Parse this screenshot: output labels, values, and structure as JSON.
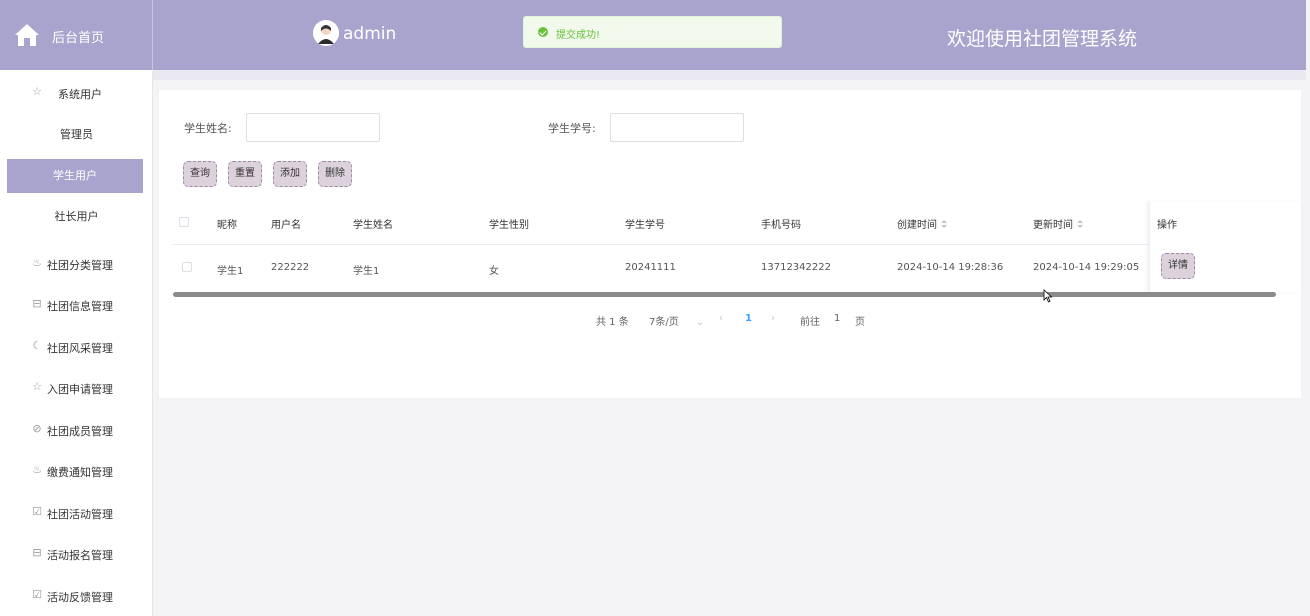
{
  "header": {
    "home_label": "后台首页",
    "user_name": "admin",
    "toast_text": "提交成功!",
    "site_title": "欢迎使用社团管理系统",
    "bg_color": "#a9a4cd"
  },
  "sidebar": {
    "group_system": {
      "icon": "star-icon",
      "label": "系统用户"
    },
    "sub_items": [
      {
        "label": "管理员",
        "active": false
      },
      {
        "label": "学生用户",
        "active": true
      },
      {
        "label": "社长用户",
        "active": false
      }
    ],
    "items": [
      {
        "icon": "flame-icon",
        "label": "社团分类管理"
      },
      {
        "icon": "basket-icon",
        "label": "社团信息管理"
      },
      {
        "icon": "moon-icon",
        "label": "社团风采管理"
      },
      {
        "icon": "star-icon",
        "label": "入团申请管理"
      },
      {
        "icon": "compass-icon",
        "label": "社团成员管理"
      },
      {
        "icon": "flame-icon",
        "label": "缴费通知管理"
      },
      {
        "icon": "calendar-check-icon",
        "label": "社团活动管理"
      },
      {
        "icon": "basket-icon",
        "label": "活动报名管理"
      },
      {
        "icon": "calendar-check-icon",
        "label": "活动反馈管理"
      }
    ]
  },
  "search": {
    "name_label": "学生姓名:",
    "name_value": "",
    "id_label": "学生学号:",
    "id_value": ""
  },
  "buttons": {
    "query": "查询",
    "reset": "重置",
    "add": "添加",
    "delete": "删除"
  },
  "table": {
    "headers": {
      "nickname": "昵称",
      "username": "用户名",
      "student_name": "学生姓名",
      "gender": "学生性别",
      "student_id": "学生学号",
      "phone": "手机号码",
      "created": "创建时间",
      "updated": "更新时间",
      "actions": "操作"
    },
    "rows": [
      {
        "nickname": "学生1",
        "username": "222222",
        "student_name": "学生1",
        "gender": "女",
        "student_id": "20241111",
        "phone": "13712342222",
        "created": "2024-10-14 19:28:36",
        "updated": "2024-10-14 19:29:05",
        "action_label": "详情"
      }
    ]
  },
  "pagination": {
    "total": "共 1 条",
    "page_size": "7条/页",
    "current_page": "1",
    "goto_prefix": "前往",
    "goto_value": "1",
    "goto_suffix": "页"
  }
}
